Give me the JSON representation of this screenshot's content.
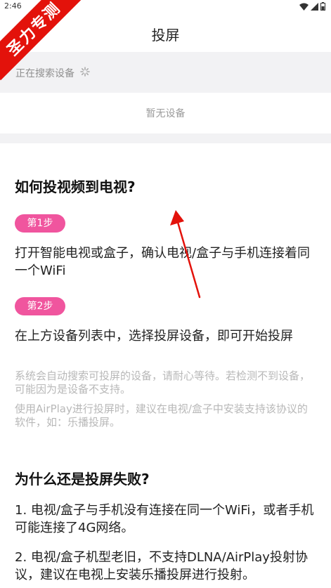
{
  "status_bar": {
    "time": "2:46",
    "icons": [
      "wifi-icon",
      "signal-icon",
      "battery-icon"
    ]
  },
  "watermark": {
    "text": "圣力专测"
  },
  "header": {
    "title": "投屏"
  },
  "device_search": {
    "status": "正在搜索设备",
    "empty": "暂无设备"
  },
  "help": {
    "how_title": "如何投视频到电视?",
    "steps": [
      {
        "badge": "第1步",
        "text": "打开智能电视或盒子，确认电视/盒子与手机连接着同一个WiFi"
      },
      {
        "badge": "第2步",
        "text": "在上方设备列表中，选择投屏设备，即可开始投屏"
      }
    ],
    "notes": [
      "系统会自动搜索可投屏的设备，请耐心等待。若检测不到设备，可能因为是设备不支持。",
      "使用AirPlay进行投屏时，建议在电视/盒子中安装支持该协议的软件，如：乐播投屏。"
    ],
    "fail_title": "为什么还是投屏失败?",
    "reasons": [
      "1. 电视/盒子与手机没有连接在同一个WiFi，或者手机可能连接了4G网络。",
      "2. 电视/盒子机型老旧，不支持DLNA/AirPlay投射协议，建议在电视上安装乐播投屏进行投射。"
    ]
  },
  "colors": {
    "badge": "#f0559e",
    "ribbon": "#e3120b",
    "annotation_arrow": "#e3120b",
    "background": "#f2f2f4"
  }
}
